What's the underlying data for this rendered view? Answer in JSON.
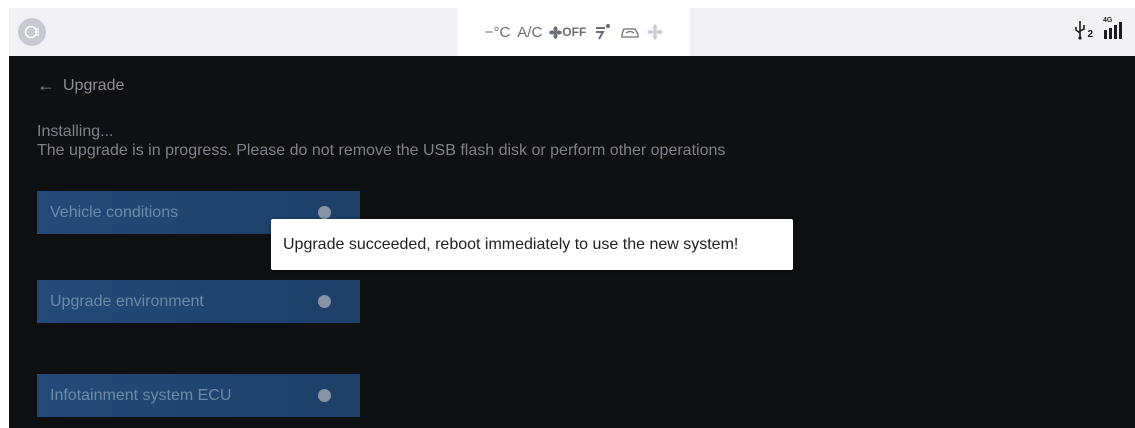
{
  "status_bar": {
    "temperature": "−°C",
    "ac_label": "A/C",
    "fan_state": "OFF",
    "home_icon": "home-button-icon",
    "usb_label": "2",
    "network_label": "4G"
  },
  "header": {
    "back_arrow": "←",
    "title": "Upgrade"
  },
  "progress": {
    "status": "Installing...",
    "message": "The upgrade is in progress. Please do not remove the USB flash disk or perform other operations"
  },
  "checks": [
    {
      "label": "Vehicle conditions"
    },
    {
      "label": "Upgrade environment"
    },
    {
      "label": "Infotainment system ECU"
    }
  ],
  "toast": {
    "text": "Upgrade succeeded, reboot immediately to use the new system!"
  },
  "colors": {
    "screen_bg": "#0f1012",
    "check_row": "#234a78",
    "status_bar": "#f2f2f4"
  }
}
